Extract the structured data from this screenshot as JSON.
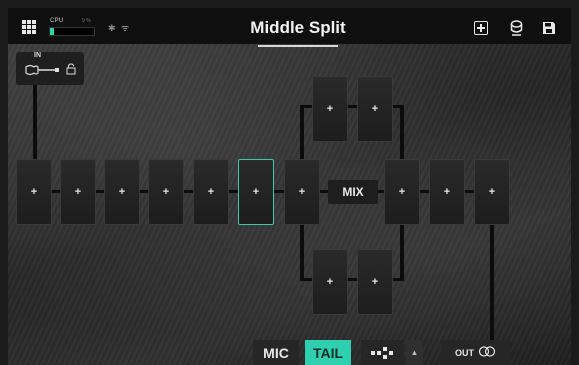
{
  "topbar": {
    "preset_name": "Middle Split",
    "cpu_label": "CPU",
    "cpu_percent_text": "9 %",
    "cpu_level": 0.1,
    "icons": [
      "grid-menu-icon",
      "bluetooth-icon",
      "wifi-icon",
      "add-preset-icon",
      "tuner-icon",
      "save-icon"
    ]
  },
  "input": {
    "label": "IN",
    "icons": [
      "guitar-icon",
      "lock-icon"
    ]
  },
  "grid": {
    "add_glyph": "+",
    "mix_label": "MIX",
    "selected_slot": "row1-6",
    "accent_color": "#2fd0b0"
  },
  "bottombar": {
    "mic_label": "MIC",
    "tail_label": "TAIL",
    "up_glyph": "▲",
    "out_label": "OUT",
    "tail_active": true
  }
}
